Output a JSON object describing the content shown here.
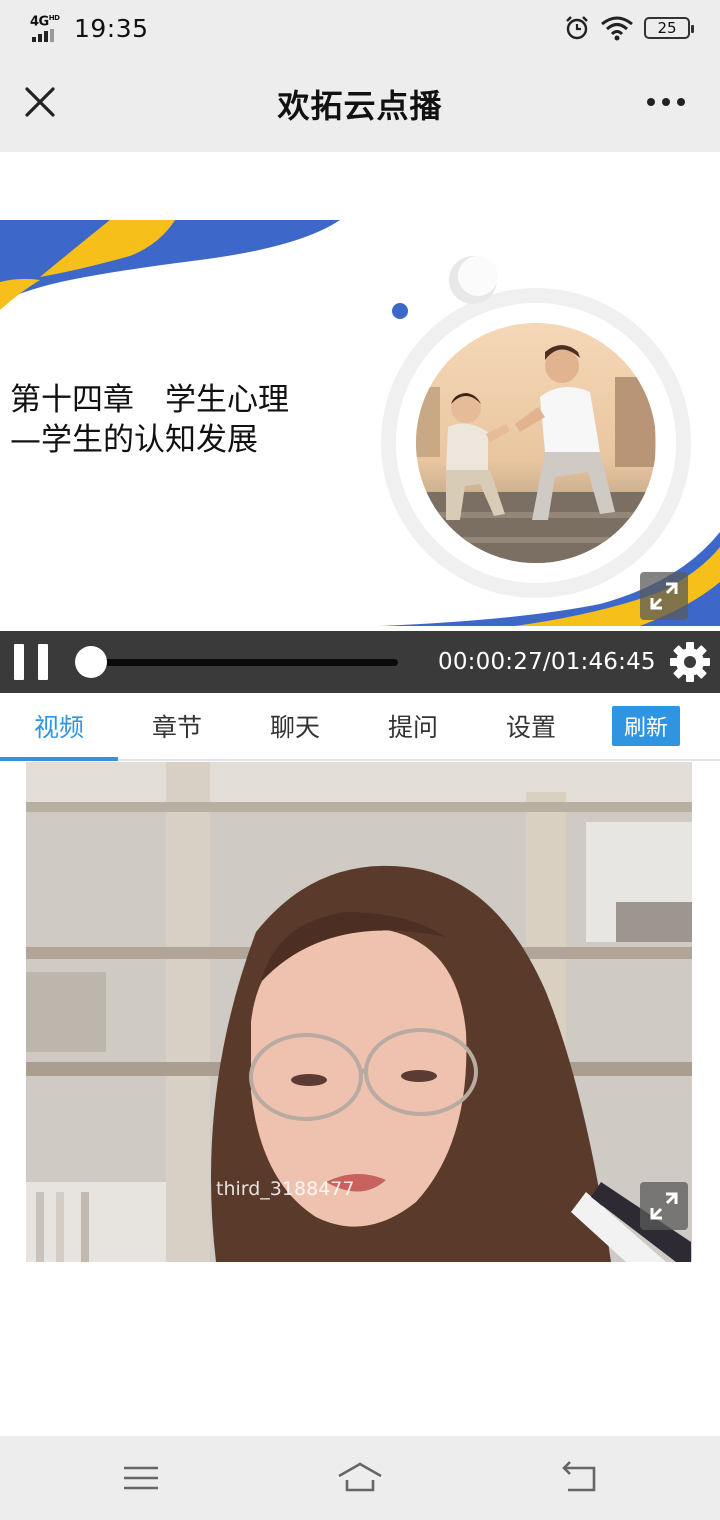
{
  "status_bar": {
    "network": "4G",
    "network_sup": "HD",
    "time": "19:35",
    "battery": "25"
  },
  "header": {
    "title": "欢拓云点播"
  },
  "slide": {
    "title_line1": "第十四章　学生心理",
    "title_line2": "—学生的认知发展"
  },
  "player": {
    "progress_fraction": 0.004,
    "time_current": "00:00:27",
    "time_separator": "/",
    "time_total": "01:46:45"
  },
  "tabs": [
    {
      "label": "视频",
      "active": true
    },
    {
      "label": "章节",
      "active": false
    },
    {
      "label": "聊天",
      "active": false
    },
    {
      "label": "提问",
      "active": false
    },
    {
      "label": "设置",
      "active": false
    }
  ],
  "refresh_label": "刷新",
  "camera": {
    "label": "third_3188477"
  },
  "colors": {
    "accent": "#2f95e0",
    "slide_blue": "#3d67c9",
    "slide_yellow": "#f7bf1a"
  }
}
